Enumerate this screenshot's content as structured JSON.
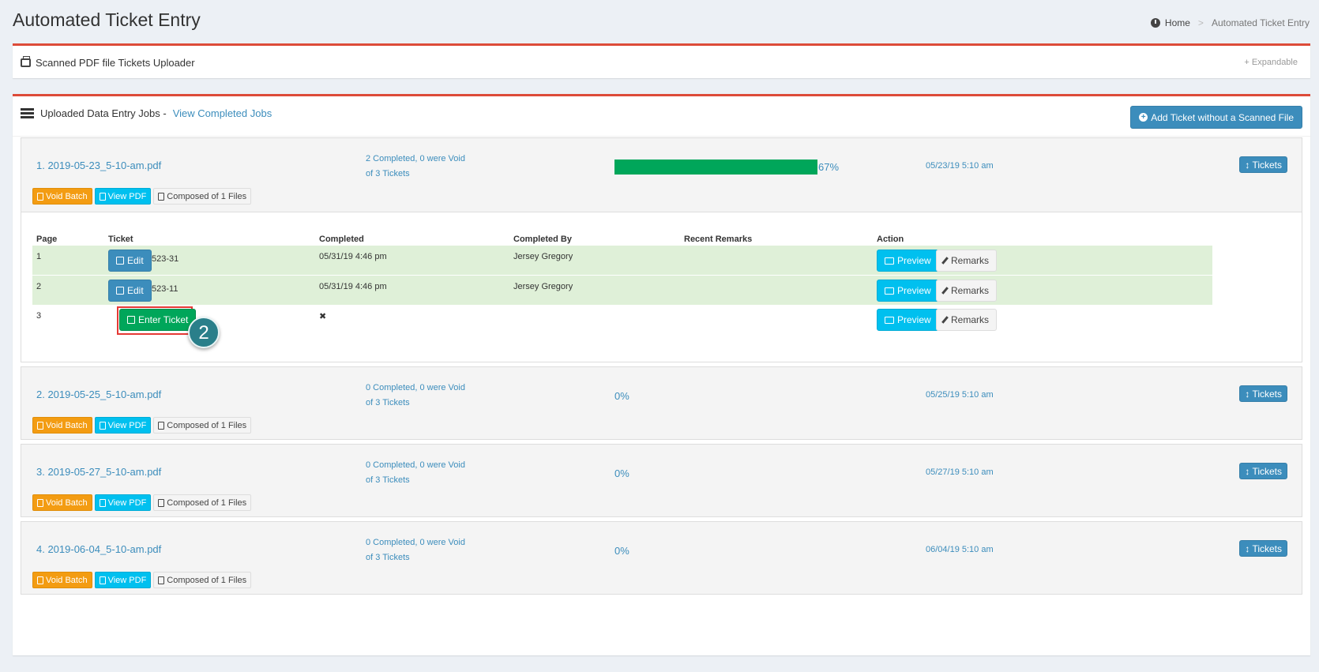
{
  "page": {
    "title": "Automated Ticket Entry"
  },
  "breadcrumb": {
    "home": "Home",
    "current": "Automated Ticket Entry"
  },
  "uploader_box": {
    "title": "Scanned PDF file Tickets Uploader",
    "expand_label": "+ Expandable"
  },
  "jobs_box": {
    "title": "Uploaded Data Entry Jobs -",
    "completed_link": "View Completed Jobs",
    "add_button": "Add Ticket without a Scanned File"
  },
  "jobs": [
    {
      "name": "1. 2019-05-23_5-10-am.pdf",
      "status_line1": "2 Completed, 0 were Void",
      "status_line2": "of 3 Tickets",
      "progress": 67,
      "progress_label": "67%",
      "date": "05/23/19 5:10 am",
      "tickets_button": "Tickets",
      "void_label": "Void Batch",
      "view_label": "View PDF",
      "files_label": "Composed of 1 Files"
    },
    {
      "name": "2. 2019-05-25_5-10-am.pdf",
      "status_line1": "0 Completed, 0 were Void",
      "status_line2": "of 3 Tickets",
      "progress": 0,
      "progress_label": "0%",
      "date": "05/25/19 5:10 am",
      "tickets_button": "Tickets",
      "void_label": "Void Batch",
      "view_label": "View PDF",
      "files_label": "Composed of 1 Files"
    },
    {
      "name": "3. 2019-05-27_5-10-am.pdf",
      "status_line1": "0 Completed, 0 were Void",
      "status_line2": "of 3 Tickets",
      "progress": 0,
      "progress_label": "0%",
      "date": "05/27/19 5:10 am",
      "tickets_button": "Tickets",
      "void_label": "Void Batch",
      "view_label": "View PDF",
      "files_label": "Composed of 1 Files"
    },
    {
      "name": "4. 2019-06-04_5-10-am.pdf",
      "status_line1": "0 Completed, 0 were Void",
      "status_line2": "of 3 Tickets",
      "progress": 0,
      "progress_label": "0%",
      "date": "06/04/19 5:10 am",
      "tickets_button": "Tickets",
      "void_label": "Void Batch",
      "view_label": "View PDF",
      "files_label": "Composed of 1 Files"
    }
  ],
  "ticket_table": {
    "headers": {
      "page": "Page",
      "ticket": "Ticket",
      "completed": "Completed",
      "completed_by": "Completed By",
      "remarks": "Recent Remarks",
      "action": "Action"
    },
    "rows": [
      {
        "page": "1",
        "button": "Edit",
        "ticket_no": "523-31",
        "completed": "05/31/19 4:46 pm",
        "completed_by": "Jersey Gregory",
        "preview": "Preview",
        "remarks": "Remarks"
      },
      {
        "page": "2",
        "button": "Edit",
        "ticket_no": "523-11",
        "completed": "05/31/19 4:46 pm",
        "completed_by": "Jersey Gregory",
        "preview": "Preview",
        "remarks": "Remarks"
      },
      {
        "page": "3",
        "button": "Enter Ticket",
        "ticket_no": "",
        "completed": "✖",
        "completed_by": "",
        "preview": "Preview",
        "remarks": "Remarks"
      }
    ]
  },
  "annotation": {
    "step": "2"
  },
  "colors": {
    "accent": "#3c8dbc",
    "success": "#00a65a",
    "warning": "#f39c12",
    "info": "#00c0ef",
    "danger": "#dd4b39",
    "row_done": "#dff0d8"
  }
}
